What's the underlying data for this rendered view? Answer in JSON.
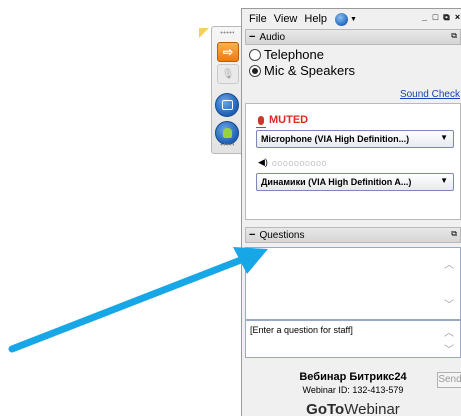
{
  "menu": {
    "file": "File",
    "view": "View",
    "help": "Help"
  },
  "window_controls": {
    "minimize": "_",
    "restore": "□",
    "popout": "⧉",
    "close": "×"
  },
  "audio": {
    "header": "Audio",
    "options": [
      {
        "label": "Telephone",
        "selected": false
      },
      {
        "label": "Mic & Speakers",
        "selected": true
      }
    ],
    "sound_check": "Sound Check",
    "mic_status": "MUTED",
    "microphone": "Microphone (VIA High Definition...)",
    "speaker_level_dots": "oooooooooo",
    "speakers": "Динамики (VIA High Definition A...)"
  },
  "questions": {
    "header": "Questions",
    "input_placeholder": "[Enter a question for staff]",
    "send_label": "Send"
  },
  "webinar": {
    "title": "Вебинар Битрикс24",
    "id_line": "Webinar ID: 132-413-579",
    "brand_bold": "GoTo",
    "brand_rest": "Webinar"
  },
  "colors": {
    "muted": "#e02a1f",
    "link": "#1a3fb3",
    "arrow": "#17a7e6",
    "toolbar_orange": "#ee7a12"
  }
}
